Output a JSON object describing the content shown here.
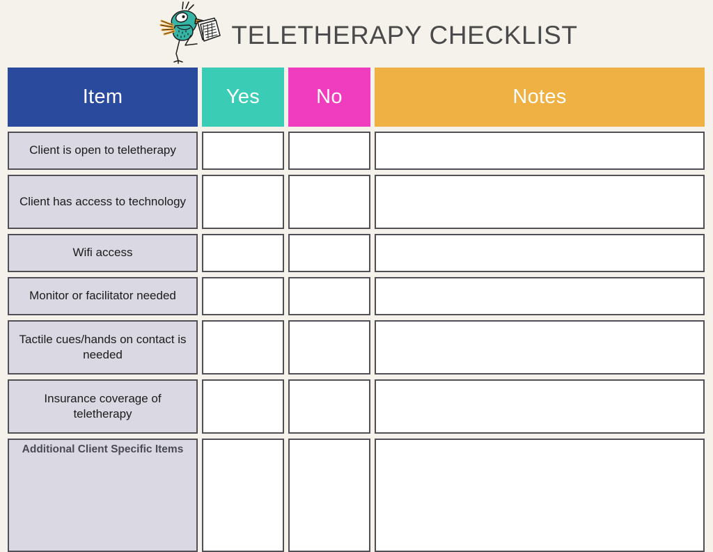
{
  "header": {
    "title": "TELETHERAPY CHECKLIST",
    "logo_icon": "bird-with-clipboard-icon"
  },
  "colors": {
    "page_background": "#f5f2ec",
    "title_text": "#4a4a4a",
    "item_header": "#2a4a9e",
    "yes_header": "#3bccb5",
    "no_header": "#f03dc0",
    "notes_header": "#efb044",
    "item_cell_fill": "#d9d8e3",
    "input_cell_fill": "#ffffff",
    "cell_border": "#4f4f55"
  },
  "table": {
    "columns": [
      {
        "key": "item",
        "label": "Item"
      },
      {
        "key": "yes",
        "label": "Yes"
      },
      {
        "key": "no",
        "label": "No"
      },
      {
        "key": "notes",
        "label": "Notes"
      }
    ],
    "rows": [
      {
        "item": "Client is open to teletherapy",
        "yes": "",
        "no": "",
        "notes": ""
      },
      {
        "item": "Client has access to technology",
        "yes": "",
        "no": "",
        "notes": ""
      },
      {
        "item": "Wifi access",
        "yes": "",
        "no": "",
        "notes": ""
      },
      {
        "item": "Monitor or facilitator needed",
        "yes": "",
        "no": "",
        "notes": ""
      },
      {
        "item": "Tactile cues/hands on contact is needed",
        "yes": "",
        "no": "",
        "notes": ""
      },
      {
        "item": "Insurance coverage of teletherapy",
        "yes": "",
        "no": "",
        "notes": ""
      },
      {
        "item": "Additional Client Specific Items",
        "yes": "",
        "no": "",
        "notes": ""
      }
    ]
  }
}
